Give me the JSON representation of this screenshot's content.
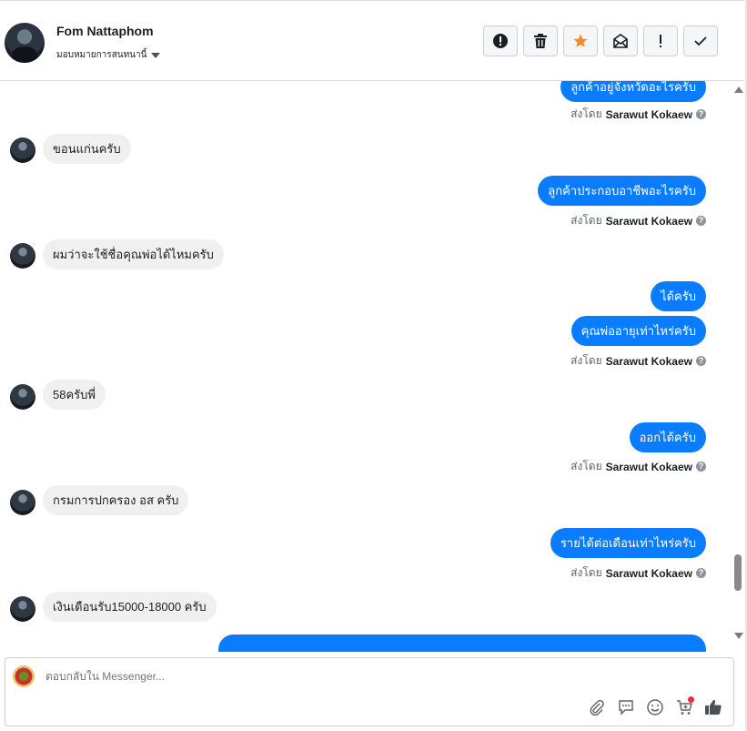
{
  "header": {
    "contact_name": "Fom Nattaphom",
    "assign_label": "มอบหมายการสนทนานี้"
  },
  "actions": [
    {
      "name": "report-spam-button",
      "icon": "alert-circle-icon"
    },
    {
      "name": "delete-button",
      "icon": "trash-icon"
    },
    {
      "name": "star-button",
      "icon": "star-icon",
      "color": "#f28d27"
    },
    {
      "name": "mark-unread-button",
      "icon": "envelope-icon"
    },
    {
      "name": "follow-up-button",
      "icon": "exclamation-icon"
    },
    {
      "name": "mark-done-button",
      "icon": "check-icon"
    }
  ],
  "messages": {
    "m1": "ลูกค้าอยู่จังหวัดอะไรครับ",
    "m2": "ขอนแก่นครับ",
    "m3": "ลูกค้าประกอบอาชีพอะไรครับ",
    "m4": "ผมว่าจะใช้ชื่อคุณพ่อได้ไหมครับ",
    "m5": "ได้ครับ",
    "m6": "คุณพ่ออายุเท่าไหร่ครับ",
    "m7": "58ครับพี่",
    "m8": "ออกได้ครับ",
    "m9": "กรมการปกครอง อส ครับ",
    "m10": "รายได้ต่อเดือนเท่าไหร่ครับ",
    "m11": "เงินเดือนรับ15000-18000 ครับ"
  },
  "sent_by": {
    "prefix": "ส่งโดย",
    "agent": "Sarawut Kokaew"
  },
  "composer": {
    "placeholder": "ตอบกลับใน Messenger..."
  },
  "colors": {
    "outgoing_bubble": "#0a7cff",
    "incoming_bubble": "#f0f0f0",
    "star": "#f28d27",
    "notification_dot": "#f02849"
  }
}
